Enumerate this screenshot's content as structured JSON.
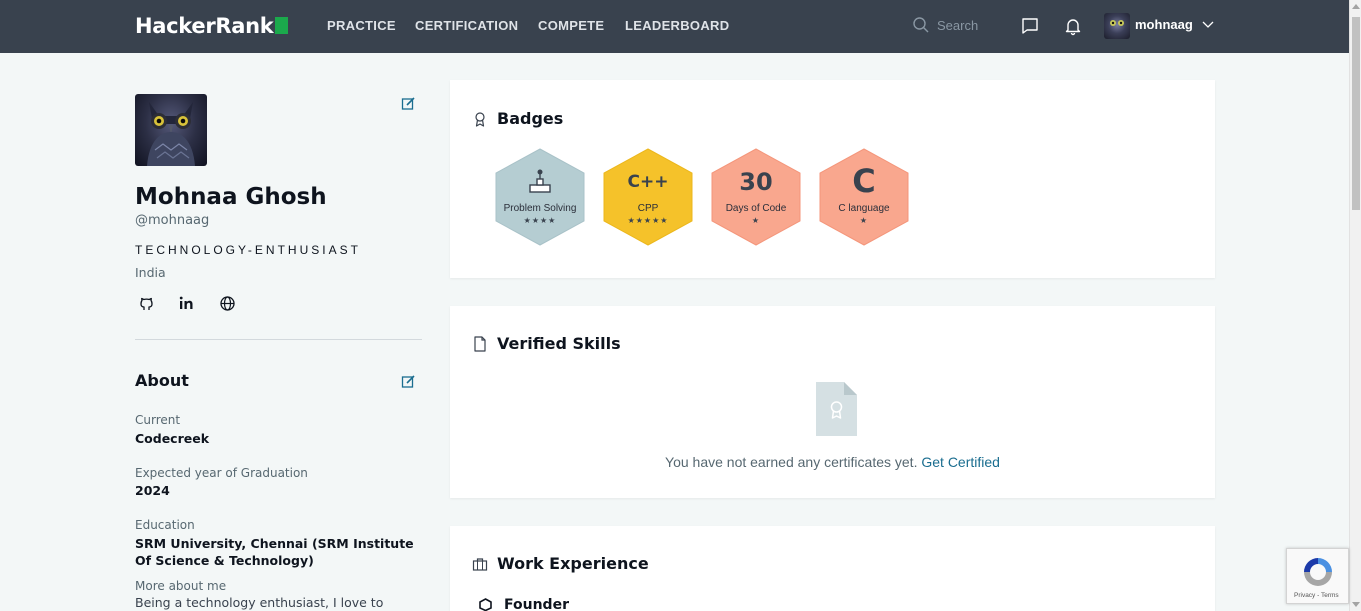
{
  "header": {
    "logo_text": "HackerRank",
    "nav": [
      "PRACTICE",
      "CERTIFICATION",
      "COMPETE",
      "LEADERBOARD"
    ],
    "search_placeholder": "Search",
    "username": "mohnaag"
  },
  "profile": {
    "name": "Mohnaa Ghosh",
    "handle": "@mohnaag",
    "tagline": "TECHNOLOGY-ENTHUSIAST",
    "country": "India",
    "social": [
      "github-icon",
      "linkedin-icon",
      "globe-icon"
    ]
  },
  "about": {
    "title": "About",
    "current_label": "Current",
    "current_value": "Codecreek",
    "grad_label": "Expected year of Graduation",
    "grad_value": "2024",
    "education_label": "Education",
    "education_value": "SRM University, Chennai (SRM Institute Of Science & Technology)",
    "more_label": "More about me",
    "more_value": "Being a technology enthusiast, I love to explore"
  },
  "badges": {
    "title": "Badges",
    "items": [
      {
        "name": "Problem Solving",
        "symbol": "⚙",
        "stars": "★★★★",
        "color": "#b5cdd2"
      },
      {
        "name": "CPP",
        "symbol": "C++",
        "stars": "★★★★★",
        "color": "#f2c11d"
      },
      {
        "name": "Days of Code",
        "symbol": "30",
        "stars": "★",
        "color": "#f9a28a"
      },
      {
        "name": "C language",
        "symbol": "C",
        "stars": "★",
        "color": "#f9a28a"
      }
    ]
  },
  "verified_skills": {
    "title": "Verified Skills",
    "empty_message": "You have not earned any certificates yet.",
    "link_text": "Get Certified"
  },
  "work_experience": {
    "title": "Work Experience",
    "first_item": "Founder"
  },
  "recaptcha": {
    "text": "Privacy - Terms"
  }
}
